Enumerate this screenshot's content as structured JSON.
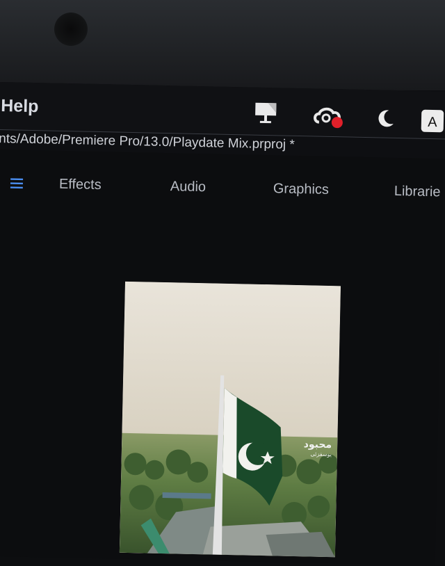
{
  "menubar": {
    "help_label": "Help",
    "status_icons": [
      "display-icon",
      "creative-cloud-sync-icon",
      "night-mode-icon",
      "input-source-icon"
    ],
    "input_source_label": "A",
    "sync_badge_color": "#e0202a"
  },
  "project": {
    "path": "nts/Adobe/Premiere Pro/13.0/Playdate Mix.prproj *"
  },
  "workspaces": {
    "menu_icon": "hamburger-icon",
    "tabs": [
      "Effects",
      "Audio",
      "Graphics",
      "Librarie"
    ]
  },
  "viewer": {
    "content": "flag-video-frame",
    "watermark_line1": "محبود",
    "watermark_line2": "یوسفزئی"
  },
  "colors": {
    "accent_blue": "#4a8df0",
    "background": "#0d0e10",
    "flag_green": "#1a4a2a"
  }
}
